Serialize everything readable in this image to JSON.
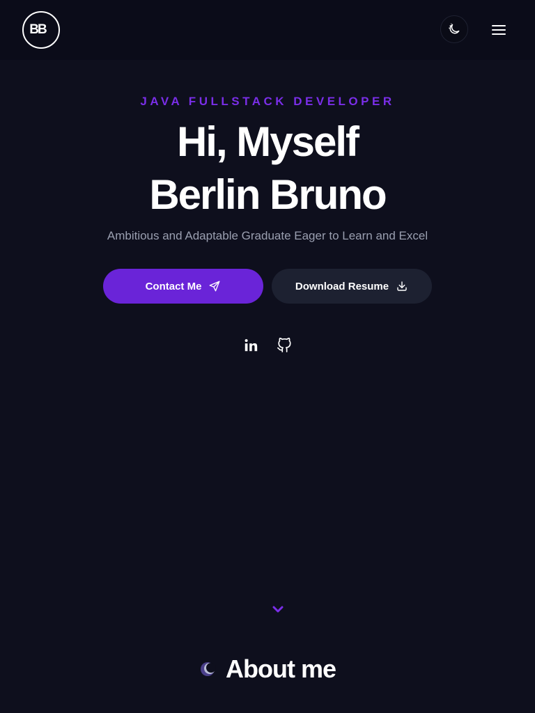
{
  "header": {
    "logo_text": "BB",
    "theme_toggle_icon": "moon-stars-icon",
    "menu_icon": "hamburger-menu-icon"
  },
  "hero": {
    "role": "JAVA FULLSTACK DEVELOPER",
    "headline_line1": "Hi, Myself",
    "headline_line2": "Berlin Bruno",
    "tagline": "Ambitious and Adaptable Graduate Eager to Learn and Excel",
    "buttons": {
      "contact_label": "Contact Me",
      "contact_icon": "send-icon",
      "resume_label": "Download Resume",
      "resume_icon": "download-icon"
    },
    "social": [
      {
        "icon": "linkedin-icon"
      },
      {
        "icon": "github-icon"
      }
    ],
    "scroll_icon": "chevron-down-icon"
  },
  "about": {
    "title": "About me",
    "icon": "crescent-icon"
  },
  "colors": {
    "background": "#0e0f1d",
    "accent": "#6a24d8",
    "accent_text": "#7a2ee8",
    "secondary_button": "#1d2131",
    "muted_text": "#9a9fb0"
  }
}
